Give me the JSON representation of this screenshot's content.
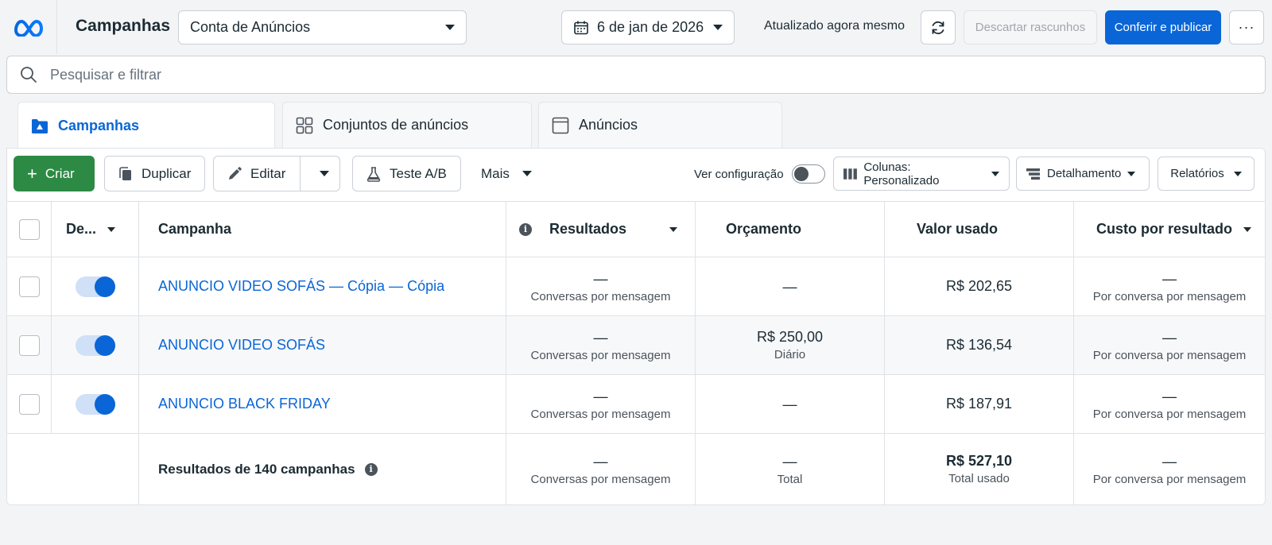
{
  "header": {
    "title": "Campanhas",
    "account": "Conta de Anúncios",
    "date": "6 de jan de 2026",
    "updated": "Atualizado agora mesmo",
    "discard_label": "Descartar rascunhos",
    "publish_label": "Conferir e publicar",
    "more_label": "···"
  },
  "search": {
    "placeholder": "Pesquisar e filtrar"
  },
  "tabs": [
    {
      "label": "Campanhas",
      "active": true
    },
    {
      "label": "Conjuntos de anúncios",
      "active": false
    },
    {
      "label": "Anúncios",
      "active": false
    }
  ],
  "toolbar": {
    "create_label": "Criar",
    "duplicate_label": "Duplicar",
    "edit_label": "Editar",
    "ab_test_label": "Teste A/B",
    "more_label": "Mais",
    "view_config_label": "Ver configuração",
    "columns_label": "Colunas: Personalizado",
    "breakdown_label": "Detalhamento",
    "reports_label": "Relatórios"
  },
  "table": {
    "columns": {
      "delivery": "De...",
      "campaign": "Campanha",
      "results": "Resultados",
      "budget": "Orçamento",
      "spent": "Valor usado",
      "cost_per_result": "Custo por resultado"
    },
    "rows": [
      {
        "name": "ANUNCIO VIDEO SOFÁS — Cópia — Cópia",
        "active": true,
        "results": "—",
        "results_sub": "Conversas por mensagem",
        "budget": "—",
        "budget_sub": "",
        "spent": "R$ 202,65",
        "cpr": "—",
        "cpr_sub": "Por conversa por mensagem"
      },
      {
        "name": "ANUNCIO VIDEO SOFÁS",
        "active": true,
        "results": "—",
        "results_sub": "Conversas por mensagem",
        "budget": "R$ 250,00",
        "budget_sub": "Diário",
        "spent": "R$ 136,54",
        "cpr": "—",
        "cpr_sub": "Por conversa por mensagem"
      },
      {
        "name": "ANUNCIO BLACK FRIDAY",
        "active": true,
        "results": "—",
        "results_sub": "Conversas por mensagem",
        "budget": "—",
        "budget_sub": "",
        "spent": "R$ 187,91",
        "cpr": "—",
        "cpr_sub": "Por conversa por mensagem"
      }
    ],
    "totals": {
      "label": "Resultados de 140 campanhas",
      "results": "—",
      "results_sub": "Conversas por mensagem",
      "budget": "—",
      "budget_sub": "Total",
      "spent": "R$ 527,10",
      "spent_sub": "Total usado",
      "cpr": "—",
      "cpr_sub": "Por conversa por mensagem"
    }
  },
  "colors": {
    "accent": "#0a66d6",
    "create_green": "#2d8a45",
    "text": "#1c2b33"
  }
}
